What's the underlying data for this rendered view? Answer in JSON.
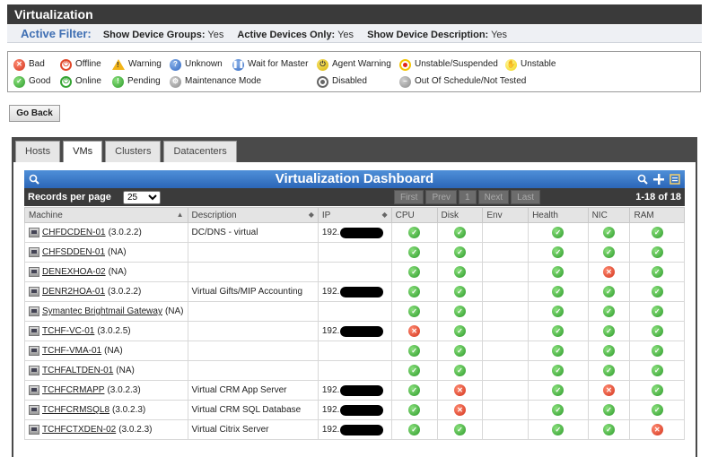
{
  "title": "Virtualization",
  "filter": {
    "label": "Active Filter:",
    "items": [
      {
        "key": "Show Device Groups:",
        "value": "Yes"
      },
      {
        "key": "Active Devices Only:",
        "value": "Yes"
      },
      {
        "key": "Show Device Description:",
        "value": "Yes"
      }
    ]
  },
  "legend": [
    {
      "icon": "bad",
      "label": "Bad"
    },
    {
      "icon": "offline",
      "label": "Offline"
    },
    {
      "icon": "warning",
      "label": "Warning"
    },
    {
      "icon": "unknown",
      "label": "Unknown"
    },
    {
      "icon": "wait",
      "label": "Wait for Master"
    },
    {
      "icon": "agent",
      "label": "Agent Warning"
    },
    {
      "icon": "unsus",
      "label": "Unstable/Suspended"
    },
    {
      "icon": "unstable",
      "label": "Unstable"
    },
    {
      "icon": "good",
      "label": "Good"
    },
    {
      "icon": "online",
      "label": "Online"
    },
    {
      "icon": "pending",
      "label": "Pending"
    },
    {
      "icon": "maint",
      "label": "Maintenance Mode"
    },
    {
      "icon": "disabled",
      "label": "Disabled"
    },
    {
      "icon": "oos",
      "label": "Out Of Schedule/Not Tested"
    }
  ],
  "go_back": "Go Back",
  "tabs": [
    {
      "label": "Hosts",
      "active": false
    },
    {
      "label": "VMs",
      "active": true
    },
    {
      "label": "Clusters",
      "active": false
    },
    {
      "label": "Datacenters",
      "active": false
    }
  ],
  "dashboard": {
    "title": "Virtualization Dashboard",
    "records_label": "Records per page",
    "records_value": "25",
    "nav": [
      "First",
      "Prev",
      "1",
      "Next",
      "Last"
    ],
    "range": "1-18 of 18",
    "columns": [
      "Machine",
      "Description",
      "IP",
      "CPU",
      "Disk",
      "Env",
      "Health",
      "NIC",
      "RAM"
    ],
    "rows": [
      {
        "name": "CHFDCDEN-01",
        "ver": "(3.0.2.2)",
        "desc": "DC/DNS - virtual",
        "ip": "192.",
        "cpu": "good",
        "disk": "good",
        "env": "",
        "health": "good",
        "nic": "good",
        "ram": "good"
      },
      {
        "name": "CHFSDDEN-01",
        "ver": "(NA)",
        "desc": "",
        "ip": "",
        "cpu": "good",
        "disk": "good",
        "env": "",
        "health": "good",
        "nic": "good",
        "ram": "good"
      },
      {
        "name": "DENEXHOA-02",
        "ver": "(NA)",
        "desc": "",
        "ip": "",
        "cpu": "good",
        "disk": "good",
        "env": "",
        "health": "good",
        "nic": "bad",
        "ram": "good"
      },
      {
        "name": "DENR2HOA-01",
        "ver": "(3.0.2.2)",
        "desc": "Virtual Gifts/MIP Accounting",
        "ip": "192.",
        "cpu": "good",
        "disk": "good",
        "env": "",
        "health": "good",
        "nic": "good",
        "ram": "good"
      },
      {
        "name": "Symantec Brightmail Gateway",
        "ver": "(NA)",
        "desc": "",
        "ip": "",
        "cpu": "good",
        "disk": "good",
        "env": "",
        "health": "good",
        "nic": "good",
        "ram": "good"
      },
      {
        "name": "TCHF-VC-01",
        "ver": "(3.0.2.5)",
        "desc": "",
        "ip": "192.",
        "cpu": "bad",
        "disk": "good",
        "env": "",
        "health": "good",
        "nic": "good",
        "ram": "good"
      },
      {
        "name": "TCHF-VMA-01",
        "ver": "(NA)",
        "desc": "",
        "ip": "",
        "cpu": "good",
        "disk": "good",
        "env": "",
        "health": "good",
        "nic": "good",
        "ram": "good"
      },
      {
        "name": "TCHFALTDEN-01",
        "ver": "(NA)",
        "desc": "",
        "ip": "",
        "cpu": "good",
        "disk": "good",
        "env": "",
        "health": "good",
        "nic": "good",
        "ram": "good"
      },
      {
        "name": "TCHFCRMAPP",
        "ver": "(3.0.2.3)",
        "desc": "Virtual CRM App Server",
        "ip": "192.",
        "cpu": "good",
        "disk": "bad",
        "env": "",
        "health": "good",
        "nic": "bad",
        "ram": "good"
      },
      {
        "name": "TCHFCRMSQL8",
        "ver": "(3.0.2.3)",
        "desc": "Virtual CRM SQL Database",
        "ip": "192.",
        "cpu": "good",
        "disk": "bad",
        "env": "",
        "health": "good",
        "nic": "good",
        "ram": "good"
      },
      {
        "name": "TCHFCTXDEN-02",
        "ver": "(3.0.2.3)",
        "desc": "Virtual Citrix Server",
        "ip": "192.",
        "cpu": "good",
        "disk": "good",
        "env": "",
        "health": "good",
        "nic": "good",
        "ram": "bad"
      }
    ]
  }
}
